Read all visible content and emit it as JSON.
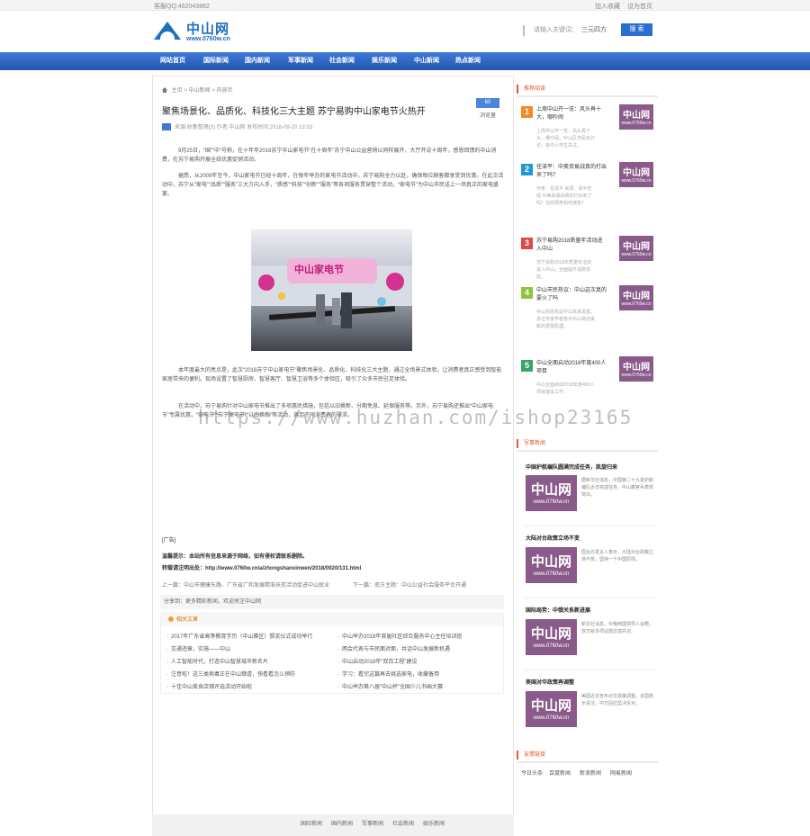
{
  "topbar": {
    "contact": "客服QQ:462043882",
    "links": [
      "加入收藏",
      "设为首页"
    ]
  },
  "logo": {
    "cn": "中山网",
    "url": "www.0760w.cn"
  },
  "search": {
    "label": "请输入关键词：",
    "keyword": "三元四方",
    "button": "搜 索"
  },
  "nav": [
    "网站首页",
    "国际新闻",
    "国内新闻",
    "军事新闻",
    "社会新闻",
    "娱乐新闻",
    "中山新闻",
    "热点新闻"
  ],
  "article": {
    "breadcrumb": [
      "主页",
      "中山新闻",
      "内容页"
    ],
    "title": "聚焦场景化、品质化、科技化三大主题 苏宁易购中山家电节火热开",
    "badge": "60",
    "badge_sub": "浏览量",
    "meta": "来源:收集整理(3)    作者:中山网    发布时间:2018-09-20 13:33",
    "para1": "9月25日，“国”“中”号称，在十年年2018苏宁中山家电节“在十周年”苏宁中山公益营销以同样展开，大厅开设十周年，感恩回馈的中山消费，在苏宁易购开展全线优惠促销活动。",
    "para2": "据悉，从2009年至今，中山家电节已经十周年，在每年举办的家电节活动中，苏宁易购全力以赴，确保每位顾客都享受到优惠。在此次活动中，苏宁从“家电”“品质”“服务”三大方向入手，“质感”“科技”“创新”“服务”等各项服务贯穿整个活动，“家电节”为中山市民送上一场真正的家电盛宴。",
    "para3": "本年度最大的亮点是，此次“2018苏宁中山家电节”聚焦场景化、品质化、科技化三大主题，通过全场景式体验，让消费者真正感受到智能家居带来的便利。现场设置了智慧厨房、智慧客厅、智慧卫浴等多个体验区，吸引了众多市民驻足体验。",
    "para4": "在活动中，苏宁易购针对中山家电节推出了多项惠民措施，包括以旧换新、分期免息、延保服务等。另外，苏宁易购还推出“中山家电节”专属优惠，“家电节”“苏宁家电节”“以旧换新”等活动，满足不同消费者的需求。",
    "share_label": "[广告]",
    "copy1": "温馨提示：本站所有信息来源于网络，如有侵权请联系删除。",
    "copy2_label": "转载请注明出处：",
    "copy2_url": "http://www.0760w.cn/a/zhongshanxinwen/2018/0920/131.html",
    "prev": "上一篇：中山市健康东路、广东省广和发展精准扶贫活动促进中山就业",
    "next": "下一篇：南方主题：中山公益社会服务平台开通",
    "share_bar": "分享到：更多精彩新闻，欢迎关注中山网",
    "related_head": "相关文章",
    "related": [
      "2017年广东省高等教育学历（中山赛区）颁奖仪式成功举行",
      "中山举办2018年首届社区综合服务中心主任培训班",
      "交通违章，实施——中山",
      "两会代表与市民面对面，共话中山发展新机遇",
      "人工智能时代，打造中山智慧城市新名片",
      "中山启动2018年“双百工程”建设",
      "注意啦！这三类病毒正在中山肆虐，快看看怎么预防",
      "学习：看完这篇再去挑选家电，收藏备用",
      "十佳中山美食店铺评选活动开始啦",
      "中山举办第八届“中山杯”全国少儿书画大赛"
    ]
  },
  "sidebar": {
    "rank_head": "推荐阅读",
    "rank": [
      {
        "num": "1",
        "color": "#f08c24",
        "title": "上周中山开一览：风头再十大，哪吵闹",
        "desc": "上周中山开一览：风头再十大，哪吵闹，中山区市民去讨论，各中小学生关注。"
      },
      {
        "num": "2",
        "color": "#1f9ad6",
        "title": "任泽平：中美贸易战真的打出来了吗？",
        "desc": "作者：任泽平 来源：泽平宏观 中美贸易战真的打出来了吗？当前局势如何演变？"
      },
      {
        "num": "3",
        "color": "#e04848",
        "title": "苏宁易购2018质量年活动进入中山",
        "desc": "苏宁易购2018年质量年活动进入中山，全面提升消费体验。"
      },
      {
        "num": "4",
        "color": "#8cc63f",
        "title": "中山市民热议：中山这次真的要火了吗",
        "desc": "中山市民热议中山未来发展，多位专家学者表示中山将迎来新的发展机遇。"
      },
      {
        "num": "5",
        "color": "#3aa56a",
        "title": "中山全面启动2018年度400人项目",
        "desc": "中山全面启动2018年度400人项目建设工作。"
      }
    ],
    "thumb_cn": "中山网",
    "thumb_url": "www.0760w.cn",
    "mil_head": "军事新闻",
    "mil": [
      {
        "title": "中国护航编队圆满完成任务，凯旋归来",
        "desc": "据新华社消息，中国第二十九批护航编队近日完成任务，中山籍官兵表现突出。"
      },
      {
        "title": "大陆对台政策立场不变",
        "desc": "国台办发言人表示，大陆对台政策立场不变，坚持一个中国原则。"
      },
      {
        "title": "国际局势：中俄关系新进展",
        "desc": "新华社消息，中俄两国领导人会晤，双方就多项议题达成共识。"
      },
      {
        "title": "美国对华政策再调整",
        "desc": "美国近日宣布对华政策调整，多国表示关注，中方回应坚决反对。"
      }
    ],
    "fl_head": "友情链接",
    "friend_links": [
      "今日头条",
      "百度新闻",
      "新浪新闻",
      "网易新闻"
    ]
  },
  "footer": [
    "国际新闻",
    "国内新闻",
    "军事新闻",
    "社会新闻",
    "娱乐新闻"
  ],
  "watermark": "https://www.huzhan.com/ishop23165"
}
